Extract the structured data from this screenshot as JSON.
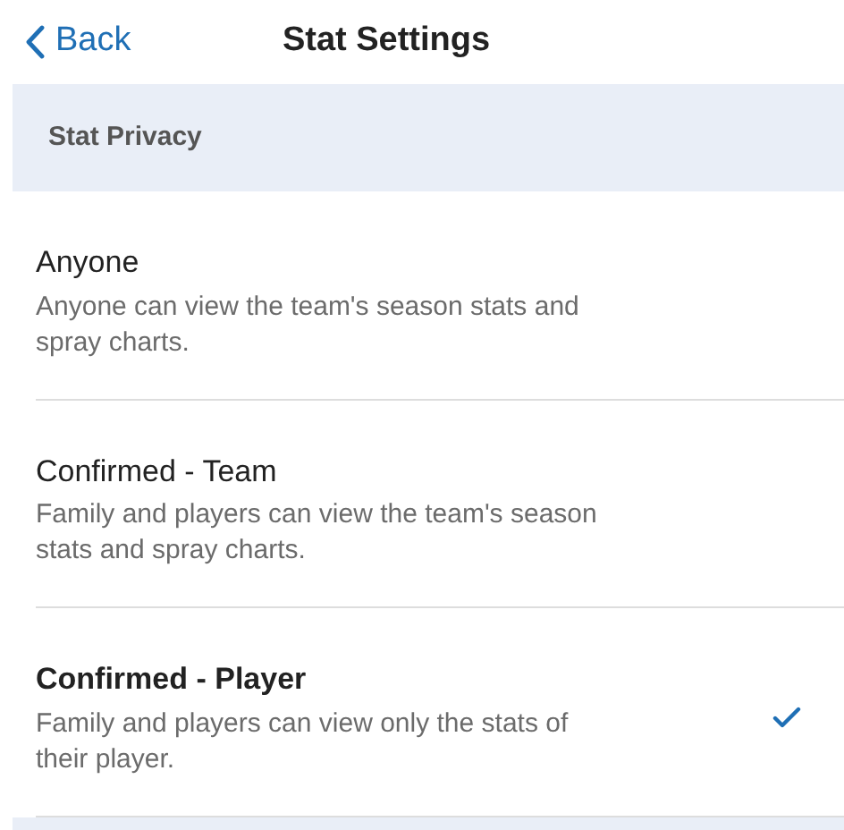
{
  "header": {
    "back": "Back",
    "title": "Stat Settings"
  },
  "section": {
    "title": "Stat Privacy"
  },
  "options": [
    {
      "title": "Anyone",
      "description": "Anyone can view the team's season stats and spray charts.",
      "selected": false
    },
    {
      "title": "Confirmed - Team",
      "description": "Family and players can view the team's season stats and spray charts.",
      "selected": false
    },
    {
      "title": "Confirmed - Player",
      "description": "Family and players can view only the stats of their player.",
      "selected": true
    }
  ]
}
